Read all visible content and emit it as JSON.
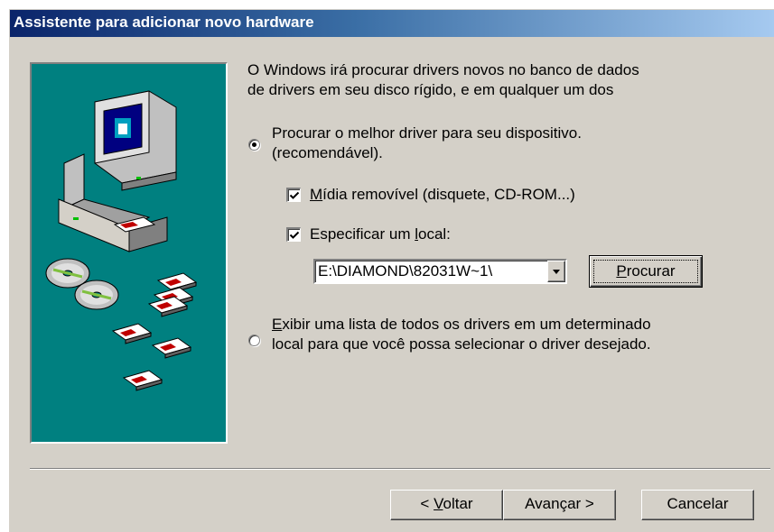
{
  "window": {
    "title": "Assistente para adicionar novo hardware"
  },
  "intro": {
    "line1": "O Windows irá procurar drivers novos no banco de dados",
    "line2": "de drivers em seu disco rígido, e em qualquer um dos"
  },
  "option_search": {
    "selected": true,
    "line1": "Procurar o melhor driver para seu dispositivo.",
    "line2": "(recomendável)."
  },
  "checkbox_removable": {
    "checked": true,
    "hotkey": "M",
    "label_rest": "ídia removível (disquete, CD-ROM...)"
  },
  "checkbox_location": {
    "checked": true,
    "label_before": "Especificar um ",
    "hotkey": "l",
    "label_after": "ocal:"
  },
  "location_combo": {
    "value": "E:\\DIAMOND\\82031W~1\\"
  },
  "browse_button": {
    "hotkey": "P",
    "label_rest": "rocurar"
  },
  "option_list": {
    "selected": false,
    "hotkey": "E",
    "line1_rest": "xibir uma lista de todos os drivers em um determinado",
    "line2": "local para que você possa selecionar o driver desejado."
  },
  "footer": {
    "back": {
      "prefix": "< ",
      "hotkey": "V",
      "rest": "oltar"
    },
    "next_label": "Avançar >",
    "cancel_label": "Cancelar"
  },
  "icons": [
    "computer-icon",
    "cd-rom-icon",
    "floppy-disk-icon",
    "checkmark-icon",
    "chevron-down-icon"
  ]
}
